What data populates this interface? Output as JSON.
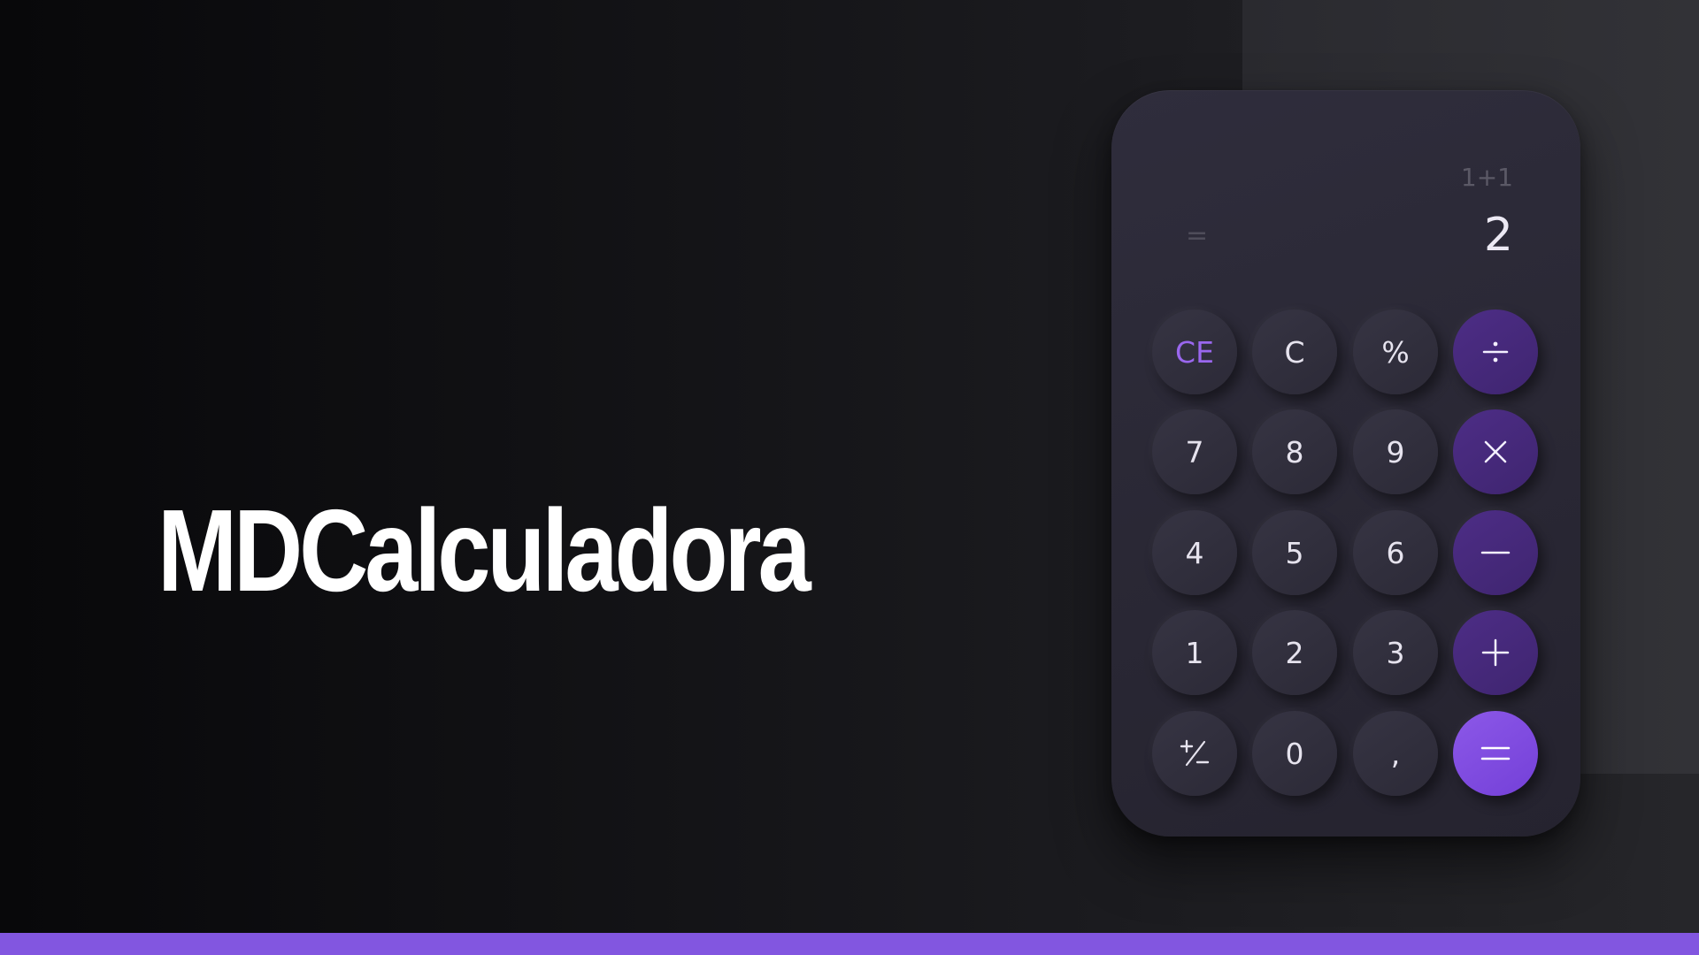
{
  "app": {
    "title": "MDCalculadora"
  },
  "display": {
    "expression": "1+1",
    "equals_sign": "=",
    "result": "2"
  },
  "keypad": {
    "rows": [
      [
        {
          "label": "CE",
          "type": "clear-entry"
        },
        {
          "label": "C",
          "type": "clear"
        },
        {
          "label": "%",
          "type": "function"
        },
        {
          "label": "÷",
          "type": "operator",
          "icon": "divide-icon"
        }
      ],
      [
        {
          "label": "7",
          "type": "digit"
        },
        {
          "label": "8",
          "type": "digit"
        },
        {
          "label": "9",
          "type": "digit"
        },
        {
          "label": "×",
          "type": "operator",
          "icon": "multiply-icon"
        }
      ],
      [
        {
          "label": "4",
          "type": "digit"
        },
        {
          "label": "5",
          "type": "digit"
        },
        {
          "label": "6",
          "type": "digit"
        },
        {
          "label": "−",
          "type": "operator",
          "icon": "minus-icon"
        }
      ],
      [
        {
          "label": "1",
          "type": "digit"
        },
        {
          "label": "2",
          "type": "digit"
        },
        {
          "label": "3",
          "type": "digit"
        },
        {
          "label": "+",
          "type": "operator",
          "icon": "plus-icon"
        }
      ],
      [
        {
          "label": "⁺∕₋",
          "type": "function",
          "icon": "plus-minus-icon"
        },
        {
          "label": "0",
          "type": "digit"
        },
        {
          "label": ",",
          "type": "decimal"
        },
        {
          "label": "=",
          "type": "equals",
          "icon": "equals-icon"
        }
      ]
    ]
  },
  "colors": {
    "accent": "#8b57e6",
    "operator_bg": "#4a2a80",
    "key_bg": "#312f3d",
    "panel_bg": "#2b2937",
    "bottom_bar": "#8256e0"
  }
}
